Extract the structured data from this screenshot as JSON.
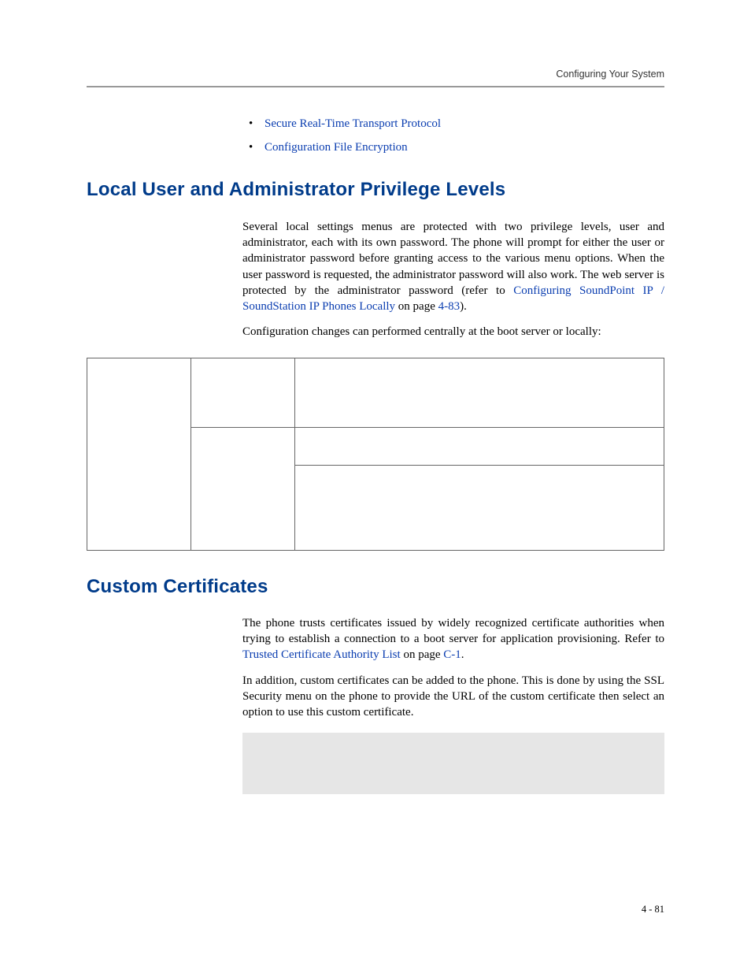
{
  "header": {
    "running_title": "Configuring Your System"
  },
  "bullets": {
    "items": [
      {
        "label": "Secure Real-Time Transport Protocol"
      },
      {
        "label": "Configuration File Encryption"
      }
    ]
  },
  "section1": {
    "heading": "Local User and Administrator Privilege Levels",
    "para1_pre": "Several local settings menus are protected with two privilege levels, user and administrator, each with its own password. The phone will prompt for either the user or administrator password before granting access to the various menu options. When the user password is requested, the administrator password will also work. The web server is protected by the administrator password (refer to ",
    "para1_link": "Configuring SoundPoint IP / SoundStation IP Phones Locally",
    "para1_mid": " on page ",
    "para1_pageref": "4-83",
    "para1_post": ").",
    "para2": "Configuration changes can performed centrally at the boot server or locally:"
  },
  "section2": {
    "heading": "Custom Certificates",
    "para1_pre": "The phone trusts certificates issued by widely recognized certificate authorities when trying to establish a connection to a boot server for application provisioning. Refer to ",
    "para1_link": "Trusted Certificate Authority List",
    "para1_mid": " on page ",
    "para1_pageref": "C-1",
    "para1_post": ".",
    "para2": "In addition, custom certificates can be added to the phone. This is done by using the SSL Security menu on the phone to provide the URL of the custom certificate then select an option to use this custom certificate."
  },
  "footer": {
    "page_number": "4 - 81"
  }
}
